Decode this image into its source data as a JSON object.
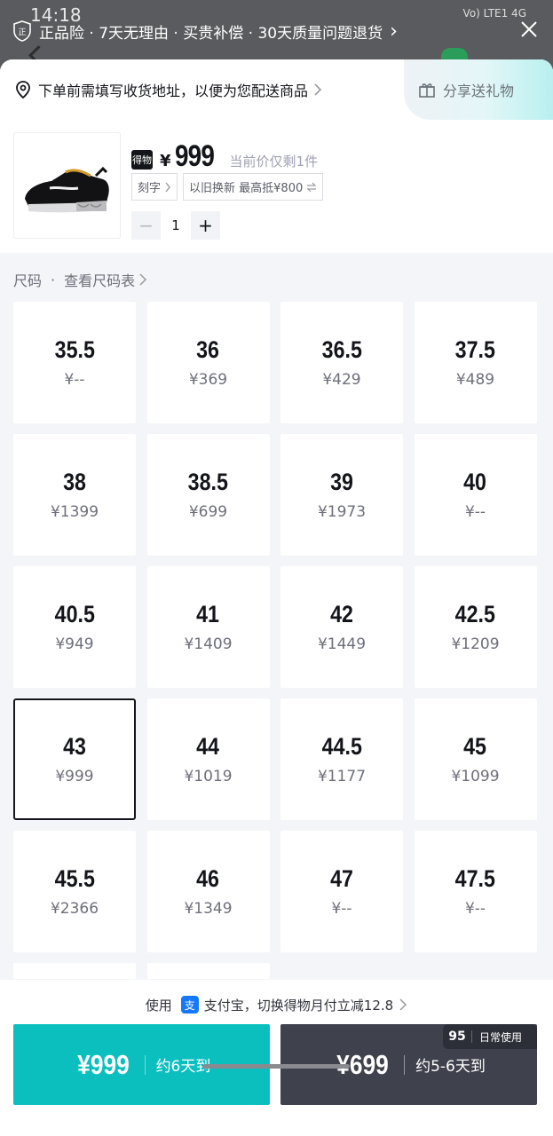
{
  "status_bar": {
    "time": "14:18",
    "network_labels": "Vo) LTE1 4G"
  },
  "guarantee_banner": {
    "text": "正品险 · 7天无理由 · 买贵补偿 · 30天质量问题退货",
    "chevron": "›"
  },
  "header": {
    "address_prompt": "下单前需填写收货地址，以便为您配送商品",
    "share_label": "分享送礼物"
  },
  "product": {
    "brand_logo_text": "得物",
    "currency": "¥",
    "price": "999",
    "stock_note": "当前价仅剩1件",
    "tag_engrave": "刻字",
    "tag_trade_in": "以旧换新 最高抵¥800",
    "quantity": "1",
    "minus": "−",
    "plus": "+"
  },
  "size_section": {
    "label": "尺码",
    "dot": "·",
    "chart_link": "查看尺码表",
    "selected_size": "43",
    "sizes": [
      {
        "size": "35.5",
        "price": "¥--"
      },
      {
        "size": "36",
        "price": "¥369"
      },
      {
        "size": "36.5",
        "price": "¥429"
      },
      {
        "size": "37.5",
        "price": "¥489"
      },
      {
        "size": "38",
        "price": "¥1399"
      },
      {
        "size": "38.5",
        "price": "¥699"
      },
      {
        "size": "39",
        "price": "¥1973"
      },
      {
        "size": "40",
        "price": "¥--"
      },
      {
        "size": "40.5",
        "price": "¥949"
      },
      {
        "size": "41",
        "price": "¥1409"
      },
      {
        "size": "42",
        "price": "¥1449"
      },
      {
        "size": "42.5",
        "price": "¥1209"
      },
      {
        "size": "43",
        "price": "¥999"
      },
      {
        "size": "44",
        "price": "¥1019"
      },
      {
        "size": "44.5",
        "price": "¥1177"
      },
      {
        "size": "45",
        "price": "¥1099"
      },
      {
        "size": "45.5",
        "price": "¥2366"
      },
      {
        "size": "46",
        "price": "¥1349"
      },
      {
        "size": "47",
        "price": "¥--"
      },
      {
        "size": "47.5",
        "price": "¥--"
      }
    ]
  },
  "footer": {
    "alipay_prefix": "使用",
    "alipay_icon_text": "支",
    "alipay_text": "支付宝，切换得物月付立减12.8",
    "buy_primary": {
      "price": "¥999",
      "eta": "约6天到"
    },
    "buy_secondary": {
      "price": "¥699",
      "eta": "约5-6天到"
    },
    "badge": {
      "grade": "95",
      "label": "日常使用"
    }
  },
  "colors": {
    "accent_teal": "#0bbfbf",
    "dark_button": "#3f414c",
    "text_primary": "#14151a",
    "text_secondary": "#6e6f7a"
  }
}
